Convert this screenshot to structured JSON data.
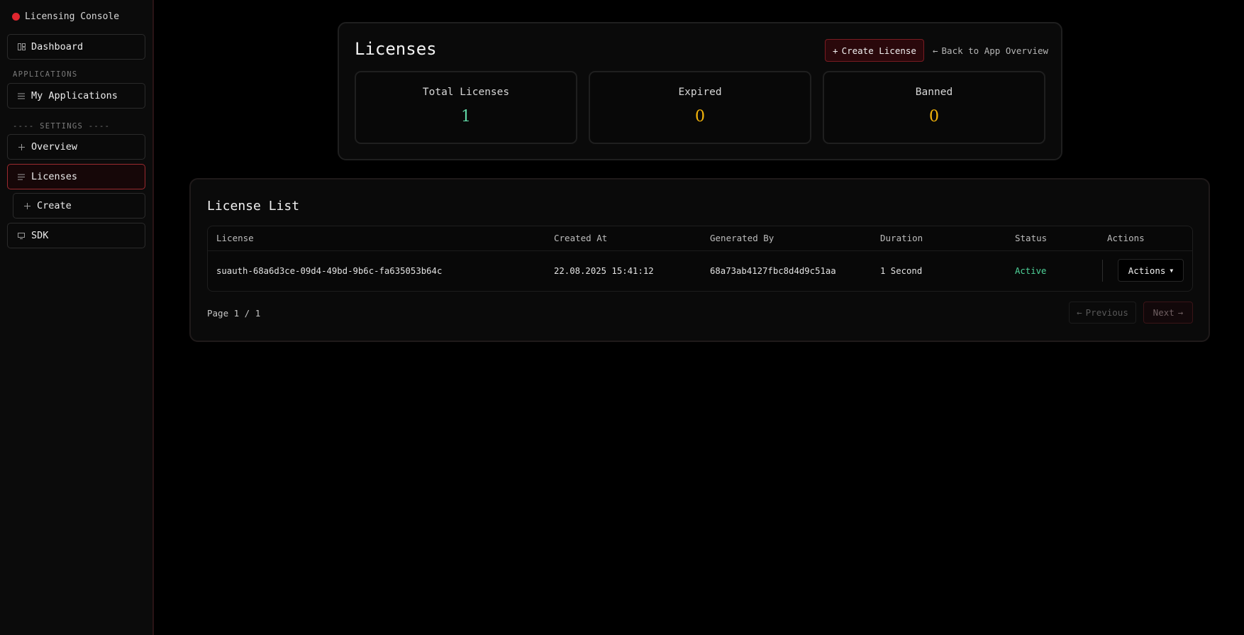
{
  "brand": {
    "title": "Licensing Console",
    "dot_color": "#e0262f"
  },
  "sidebar": {
    "dashboard": {
      "label": "Dashboard",
      "icon": "dashboard-icon"
    },
    "applications_section": "APPLICATIONS",
    "my_applications": {
      "label": "My Applications",
      "icon": "list-icon"
    },
    "settings_section": "---- SETTINGS ----",
    "overview": {
      "label": "Overview",
      "icon": "plus-icon"
    },
    "licenses": {
      "label": "Licenses",
      "icon": "lines-icon",
      "active": true
    },
    "create": {
      "label": "Create",
      "icon": "plus-icon"
    },
    "sdk": {
      "label": "SDK",
      "icon": "monitor-icon"
    }
  },
  "header": {
    "title": "Licenses",
    "create_icon": "+",
    "create_label": "Create License",
    "back_icon": "←",
    "back_label": "Back to App Overview"
  },
  "stats": [
    {
      "label": "Total Licenses",
      "value": "1",
      "color": "#5fd6a4"
    },
    {
      "label": "Expired",
      "value": "0",
      "color": "#f5b50b"
    },
    {
      "label": "Banned",
      "value": "0",
      "color": "#f5b50b"
    }
  ],
  "license_list": {
    "title": "License List",
    "columns": [
      "License",
      "Created At",
      "Generated By",
      "Duration",
      "Status",
      "Actions"
    ],
    "rows": [
      {
        "license": "suauth-68a6d3ce-09d4-49bd-9b6c-fa635053b64c",
        "created_at": "22.08.2025 15:41:12",
        "generated_by": "68a73ab4127fbc8d4d9c51aa",
        "duration": "1 Second",
        "status": "Active",
        "status_color": "#4fd49a",
        "actions_label": "Actions"
      }
    ]
  },
  "pagination": {
    "info": "Page 1 / 1",
    "prev_icon": "←",
    "prev_label": "Previous",
    "next_label": "Next",
    "next_icon": "→"
  }
}
